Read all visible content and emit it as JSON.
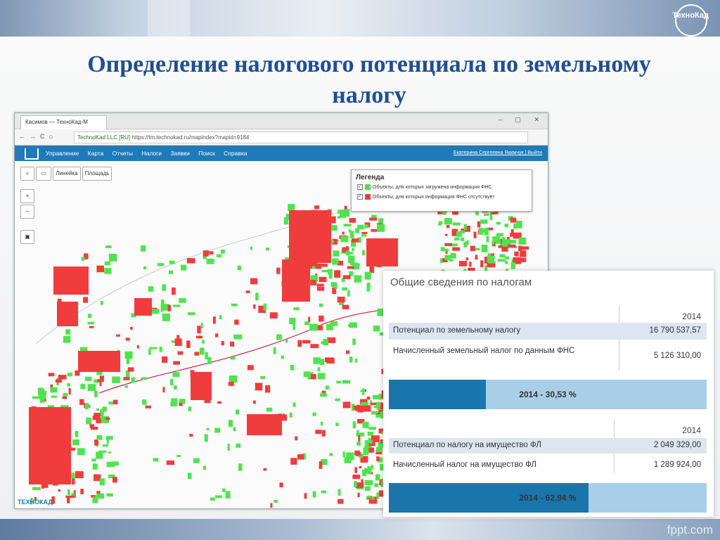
{
  "slide": {
    "title": "Определение налогового потенциала по земельному налогу",
    "logo": "ТехноКад",
    "footer": "fppt.com"
  },
  "browser": {
    "tab_title": "Касимов — ТехноКад-М",
    "nav_glyphs": "←→C⌂",
    "site_badge": "TechnoKad LLC [RU]",
    "url": "https://tm.technokad.ru/mapindex?mapid=9184",
    "window_controls": "‒ ▢ ✕"
  },
  "menu": {
    "items": [
      "Управление",
      "Карта",
      "Отчеты",
      "Налоги",
      "Заявки",
      "Поиск",
      "Справка"
    ],
    "user": "Екатерина Сергеевна Якимчук | Выйти"
  },
  "map": {
    "tool_ruler": "Линейка",
    "tool_area": "Площадь",
    "zoom_in": "+",
    "zoom_out": "−",
    "watermark": "ТЕХНОКАД",
    "legend": {
      "title": "Легенда",
      "items": [
        {
          "label": "Объекты, для которых загружена информация ФНС",
          "color": "#4fe34f"
        },
        {
          "label": "Объекты, для которых информация ФНС отсутствует",
          "color": "#f03c3c"
        }
      ]
    }
  },
  "panel": {
    "title": "Общие сведения по налогам",
    "year1": "2014",
    "rows1": [
      {
        "label": "Потенциал по земельному налогу",
        "value": "16 790 537,57"
      },
      {
        "label": "Начисленный земельный налог по данным ФНС",
        "value": "5 126 310,00"
      }
    ],
    "bar1": {
      "text": "2014 - 30,53 %",
      "percent": 30.53
    },
    "year2": "2014",
    "rows2": [
      {
        "label": "Потенциал по налогу на имущество ФЛ",
        "value": "2 049 329,00"
      },
      {
        "label": "Начисленный налог на имущество ФЛ",
        "value": "1 289 924,00"
      }
    ],
    "bar2": {
      "text": "2014 - 62,94 %",
      "percent": 62.94
    }
  },
  "colors": {
    "title": "#1f4e93",
    "menubar": "#1f7ab8",
    "progress": "#1b75ad",
    "green": "#4fe34f",
    "red": "#f03c3c"
  }
}
